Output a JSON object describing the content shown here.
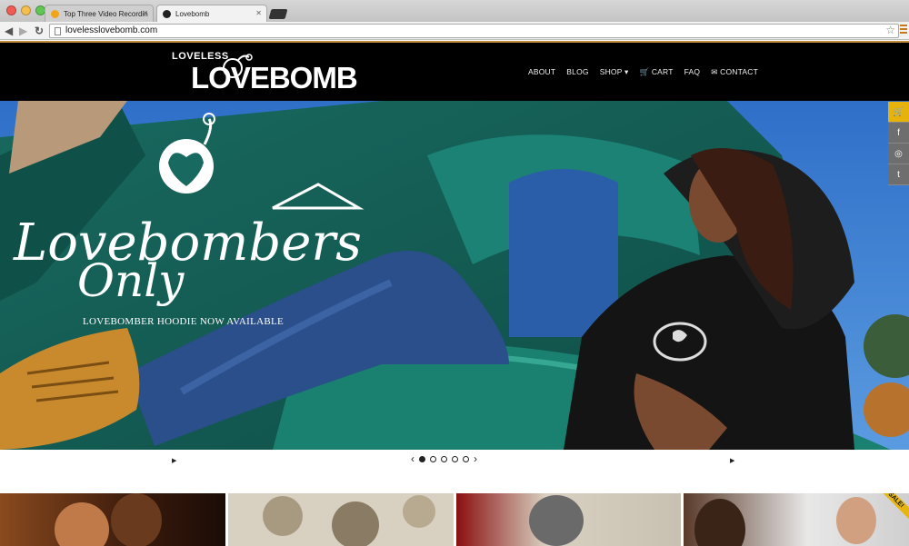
{
  "browser": {
    "tabs": [
      {
        "label": "Top Three Video Recordin"
      },
      {
        "label": "Lovebomb"
      }
    ],
    "url": "lovelesslovebomb.com"
  },
  "site": {
    "logo_small": "LOVELESS",
    "logo_big": "LOVEBOMB",
    "nav": [
      {
        "label": "ABOUT"
      },
      {
        "label": "BLOG"
      },
      {
        "label": "SHOP ▾"
      },
      {
        "label": "CART"
      },
      {
        "label": "FAQ"
      },
      {
        "label": "CONTACT"
      }
    ]
  },
  "hero": {
    "script_line1": "Lovebombers",
    "script_line2": "Only",
    "caption": "LOVEBOMBER HOODIE NOW AVAILABLE"
  },
  "social": [
    {
      "icon": "cart-icon",
      "glyph": "🛒"
    },
    {
      "icon": "facebook-icon",
      "glyph": "f"
    },
    {
      "icon": "instagram-icon",
      "glyph": "◎"
    },
    {
      "icon": "twitter-icon",
      "glyph": "t"
    }
  ],
  "slider": {
    "slide_count": 5,
    "active_index": 0
  },
  "thumbs": [
    {
      "badge": ""
    },
    {
      "badge": ""
    },
    {
      "badge": ""
    },
    {
      "badge": "SALE!"
    }
  ],
  "colors": {
    "accent": "#c58a3d",
    "cart_badge": "#e8b20c",
    "teal": "#1e7a70"
  }
}
